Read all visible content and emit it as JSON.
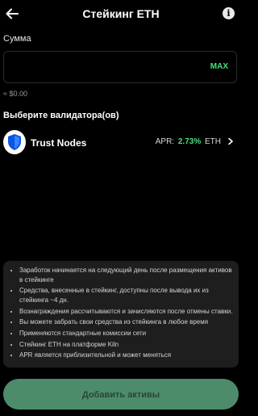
{
  "header": {
    "title": "Стейкинг ETH",
    "back_icon": "arrow-left-icon",
    "info_icon": "info-icon"
  },
  "amount": {
    "label": "Сумма",
    "value": "",
    "placeholder": "",
    "max_label": "MAX",
    "fiat": "≈ $0.00"
  },
  "validator": {
    "label": "Выберите валидатора(ов)",
    "name": "Trust Nodes",
    "icon": "trust-shield-icon",
    "apr_label": "APR:",
    "apr_value": "2.73%",
    "token": "ETH",
    "chevron_icon": "chevron-right-icon"
  },
  "info": {
    "items": [
      "Заработок начинается на следующий день после размещения активов в стейкинге",
      "Средства, внесенные в стейкинг, доступны после вывода их из стейкинга ~4 дн.",
      "Вознаграждения рассчитываются и зачисляются после отмены ставки.",
      "Вы можете забрать свои средства из стейкинга в любое время",
      "Применяются стандартные комиссии сети",
      "Стейкинг ETH на платформе Kiln",
      "APR является приблизительной и может меняться"
    ]
  },
  "actions": {
    "add_label": "Добавить активы"
  },
  "colors": {
    "background": "#000000",
    "accent_green": "#4ade80",
    "button_bg": "#4c8c6b",
    "panel_bg": "#1e1e1e"
  }
}
